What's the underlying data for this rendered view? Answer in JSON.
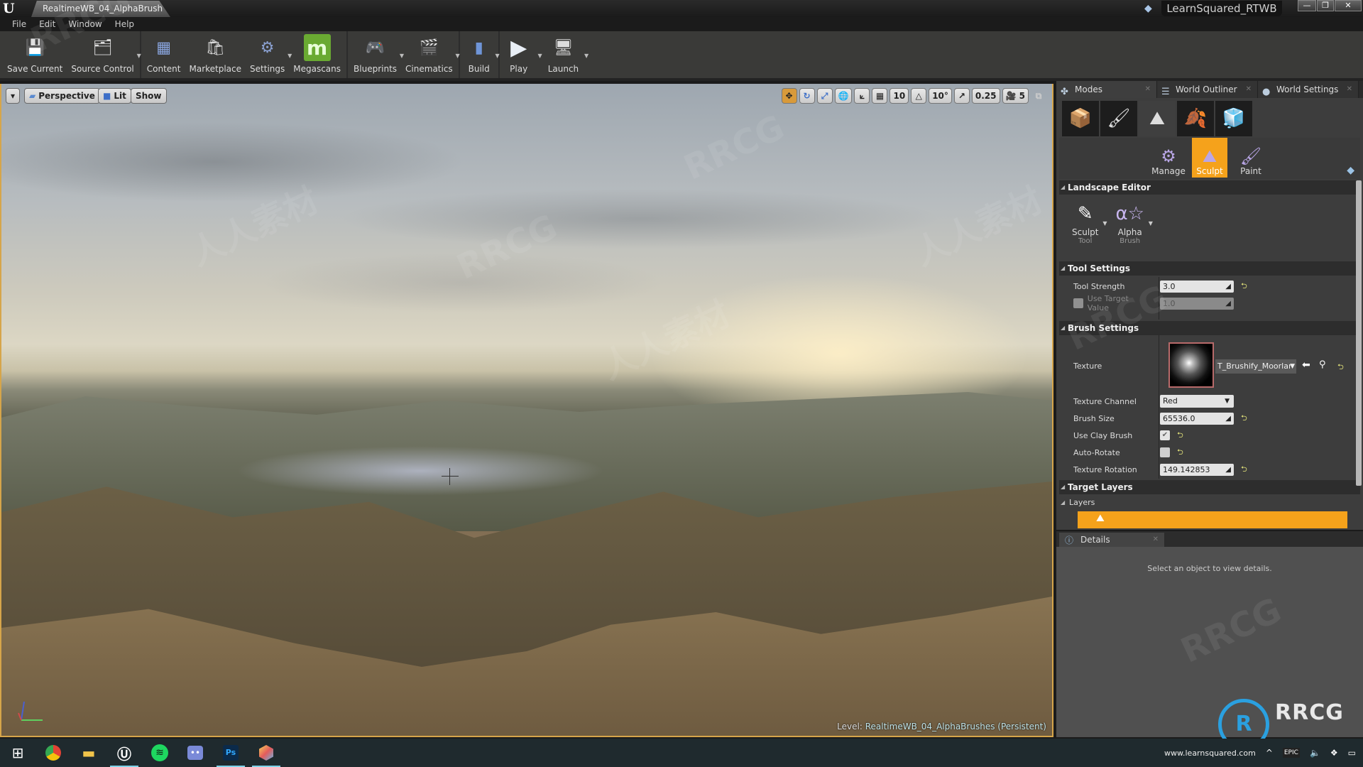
{
  "window": {
    "document_tab": "RealtimeWB_04_AlphaBrush",
    "project_name": "LearnSquared_RTWB",
    "minimize": "—",
    "maximize": "❐",
    "close": "✕"
  },
  "menu": [
    "File",
    "Edit",
    "Window",
    "Help"
  ],
  "toolbar": [
    {
      "label": "Save Current",
      "icon": "save-icon",
      "glyph": "💾",
      "dropdown": false
    },
    {
      "label": "Source Control",
      "icon": "source-control-icon",
      "glyph": "🗂",
      "dropdown": true
    },
    {
      "label": "Content",
      "icon": "content-icon",
      "glyph": "▦",
      "dropdown": false
    },
    {
      "label": "Marketplace",
      "icon": "marketplace-icon",
      "glyph": "🛍",
      "dropdown": false
    },
    {
      "label": "Settings",
      "icon": "settings-gear-icon",
      "glyph": "⚙",
      "dropdown": true
    },
    {
      "label": "Megascans",
      "icon": "megascans-icon",
      "glyph": "m",
      "dropdown": false
    },
    {
      "label": "Blueprints",
      "icon": "blueprints-icon",
      "glyph": "🎮",
      "dropdown": true
    },
    {
      "label": "Cinematics",
      "icon": "cinematics-icon",
      "glyph": "🎬",
      "dropdown": true
    },
    {
      "label": "Build",
      "icon": "build-icon",
      "glyph": "▮",
      "dropdown": true
    },
    {
      "label": "Play",
      "icon": "play-icon",
      "glyph": "▶",
      "dropdown": true
    },
    {
      "label": "Launch",
      "icon": "launch-icon",
      "glyph": "🖥",
      "dropdown": true
    }
  ],
  "viewport": {
    "menu_caret": "▾",
    "view_mode": "Perspective",
    "lighting": "Lit",
    "show": "Show",
    "grid_snap": "10",
    "rotation_snap": "10°",
    "scale_snap": "0.25",
    "camera_speed": "5",
    "level_prefix": "Level:",
    "level_name": "RealtimeWB_04_AlphaBrushes (Persistent)"
  },
  "modes_panel": {
    "tabs": [
      {
        "label": "Modes",
        "icon": "modes-icon",
        "glyph": "✤"
      },
      {
        "label": "World Outliner",
        "icon": "world-outliner-icon",
        "glyph": "☰"
      },
      {
        "label": "World Settings",
        "icon": "world-settings-icon",
        "glyph": "●"
      }
    ],
    "mode_icons": [
      {
        "name": "place-mode-icon",
        "glyph": "📦"
      },
      {
        "name": "paint-mode-icon",
        "glyph": "🖌"
      },
      {
        "name": "landscape-mode-icon",
        "glyph": "⛰"
      },
      {
        "name": "foliage-mode-icon",
        "glyph": "🍂"
      },
      {
        "name": "geometry-mode-icon",
        "glyph": "🧊"
      }
    ],
    "landscape_modes": [
      {
        "label": "Manage",
        "glyph": "⚙"
      },
      {
        "label": "Sculpt",
        "glyph": "⛰"
      },
      {
        "label": "Paint",
        "glyph": "🖌"
      }
    ],
    "active_landscape_mode": "Sculpt"
  },
  "landscape_editor": {
    "title": "Landscape Editor",
    "tool": {
      "label": "Sculpt",
      "sub": "Tool",
      "glyph": "✎"
    },
    "brush": {
      "label": "Alpha",
      "sub": "Brush",
      "glyph": "α☆"
    }
  },
  "tool_settings": {
    "title": "Tool Settings",
    "tool_strength_label": "Tool Strength",
    "tool_strength": "3.0",
    "use_target_label": "Use Target Value",
    "use_target_value": "1.0",
    "use_target_checked": false
  },
  "brush_settings": {
    "title": "Brush Settings",
    "texture_label": "Texture",
    "texture_name": "T_Brushify_Moorlar",
    "texture_channel_label": "Texture Channel",
    "texture_channel": "Red",
    "brush_size_label": "Brush Size",
    "brush_size": "65536.0",
    "use_clay_label": "Use Clay Brush",
    "use_clay_checked": true,
    "auto_rotate_label": "Auto-Rotate",
    "auto_rotate_checked": false,
    "texture_rotation_label": "Texture Rotation",
    "texture_rotation": "149.142853"
  },
  "target_layers": {
    "title": "Target Layers",
    "layers_label": "Layers"
  },
  "details": {
    "tab_label": "Details",
    "empty_message": "Select an object to view details."
  },
  "taskbar": {
    "apps": [
      "Start",
      "Chrome",
      "File Explorer",
      "Unreal Engine",
      "Spotify",
      "Discord",
      "Photoshop",
      "App"
    ],
    "tray_url": "www.learnsquared.com",
    "tray_icons": [
      "show-hidden-icon",
      "epic-games-icon",
      "volume-icon",
      "dropbox-icon",
      "notifications-icon"
    ]
  },
  "watermarks": [
    "RRCG",
    "人人素材"
  ],
  "colors": {
    "accent_orange": "#f5a21b",
    "megascans_green": "#6aaa32",
    "viewport_border": "#d6a54a",
    "reset_arrow": "#e3e37a"
  }
}
